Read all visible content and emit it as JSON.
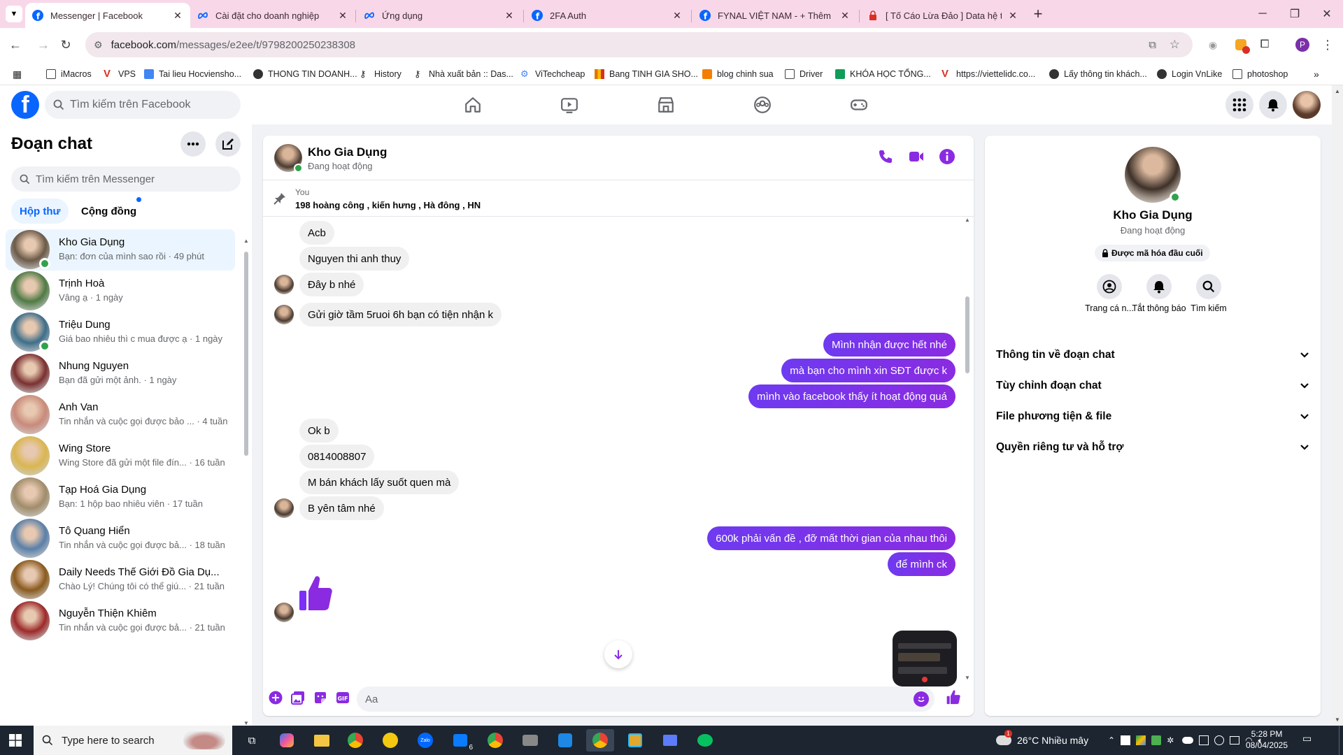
{
  "browser": {
    "tabs": [
      {
        "title": "Messenger | Facebook",
        "icon": "facebook-icon",
        "active": true
      },
      {
        "title": "Cài đặt cho doanh nghiệp",
        "icon": "meta-icon",
        "active": false
      },
      {
        "title": "Ứng dụng",
        "icon": "meta-icon",
        "active": false
      },
      {
        "title": "2FA Auth",
        "icon": "facebook-icon",
        "active": false
      },
      {
        "title": "FYNAL VIỆT NAM - + Thêm sản",
        "icon": "facebook-icon",
        "active": false
      },
      {
        "title": "[ Tố Cáo Lừa Đảo ] Data hệ thốn",
        "icon": "lock-icon",
        "active": false
      }
    ],
    "new_tab": "+",
    "url_host": "facebook.com",
    "url_path": "/messages/e2ee/t/9798200250238308",
    "profile_initial": "P",
    "bookmarks": [
      {
        "label": "iMacros",
        "icon": "folder-icon"
      },
      {
        "label": "VPS",
        "icon": "v-icon"
      },
      {
        "label": "Tai lieu Hocviensho...",
        "icon": "doc-icon"
      },
      {
        "label": "THONG TIN DOANH...",
        "icon": "globe-icon"
      },
      {
        "label": "History",
        "icon": "key-icon"
      },
      {
        "label": "Nhà xuất bản :: Das...",
        "icon": "key-icon"
      },
      {
        "label": "ViTechcheap",
        "icon": "gear-icon"
      },
      {
        "label": "Bang TINH GIA SHO...",
        "icon": "chart-icon"
      },
      {
        "label": "blog chinh sua",
        "icon": "blogger-icon"
      },
      {
        "label": "Driver",
        "icon": "folder-icon"
      },
      {
        "label": "KHÓA HỌC TỔNG...",
        "icon": "sheet-icon"
      },
      {
        "label": "https://viettelidc.co...",
        "icon": "v-icon"
      },
      {
        "label": "Lấy thông tin khách...",
        "icon": "globe-icon"
      },
      {
        "label": "Login VnLike",
        "icon": "globe-icon"
      },
      {
        "label": "photoshop",
        "icon": "folder-icon"
      }
    ]
  },
  "fb": {
    "search_placeholder": "Tìm kiếm trên Facebook",
    "logo_letter": "f"
  },
  "sidebar": {
    "title": "Đoạn chat",
    "search_placeholder": "Tìm kiếm trên Messenger",
    "tab_inbox": "Hộp thư",
    "tab_community": "Cộng đồng",
    "conversations": [
      {
        "name": "Kho Gia Dụng",
        "preview": "Bạn: đơn của mình sao rồi · 49 phút",
        "online": true,
        "active": true,
        "color": "#6b5a48"
      },
      {
        "name": "Trịnh Hoà",
        "preview": "Vâng ạ · 1 ngày",
        "online": false,
        "active": false,
        "color": "#4f7a45"
      },
      {
        "name": "Triệu Dung",
        "preview": "Giá bao nhiêu thì c mua được ạ · 1 ngày",
        "online": true,
        "active": false,
        "color": "#3d6e8a"
      },
      {
        "name": "Nhung Nguyen",
        "preview": "Bạn đã gửi một ảnh. · 1 ngày",
        "online": false,
        "active": false,
        "color": "#7a3030"
      },
      {
        "name": "Anh Van",
        "preview": "Tin nhắn và cuộc gọi được bảo ... · 4 tuần",
        "online": false,
        "active": false,
        "color": "#c98a7a"
      },
      {
        "name": "Wing Store",
        "preview": "Wing Store đã gửi một file đín... · 16 tuần",
        "online": false,
        "active": false,
        "color": "#d9b650"
      },
      {
        "name": "Tạp Hoá Gia Dụng",
        "preview": "Bạn: 1 hộp bao nhiêu viên · 17 tuần",
        "online": false,
        "active": false,
        "color": "#a08c6a"
      },
      {
        "name": "Tô Quang Hiển",
        "preview": "Tin nhắn và cuộc gọi được bả... · 18 tuần",
        "online": false,
        "active": false,
        "color": "#5a7fa8"
      },
      {
        "name": "Daily Needs Thế Giới Đồ Gia Dụ...",
        "preview": "Chào Lý! Chúng tôi có thể giú... · 21 tuần",
        "online": false,
        "active": false,
        "color": "#8a5a1e"
      },
      {
        "name": "Nguyễn Thiện Khiêm",
        "preview": "Tin nhắn và cuộc gọi được bả... · 21 tuần",
        "online": false,
        "active": false,
        "color": "#9c2a2a"
      }
    ]
  },
  "chat": {
    "name": "Kho Gia Dụng",
    "status": "Đang hoạt động",
    "pinned_sender": "You",
    "pinned_text": "198 hoàng công , kiến hưng , Hà đông , HN",
    "messages": [
      {
        "text": "Acb",
        "dir": "in",
        "avatar": false
      },
      {
        "text": "Nguyen thi anh thuy",
        "dir": "in",
        "avatar": false
      },
      {
        "text": "Đây b nhé",
        "dir": "in",
        "avatar": true
      },
      {
        "text": "Gửi giờ tầm 5ruoi 6h bạn có tiện nhận k",
        "dir": "in",
        "avatar": true
      },
      {
        "text": "Mình nhận được hết nhé",
        "dir": "out"
      },
      {
        "text": "mà bạn cho mình xin SĐT được k",
        "dir": "out"
      },
      {
        "text": "mình vào facebook thấy ít hoạt động quá",
        "dir": "out"
      },
      {
        "text": "Ok b",
        "dir": "in",
        "avatar": false
      },
      {
        "text": "0814008807",
        "dir": "in",
        "avatar": false
      },
      {
        "text": "M bán khách lấy suốt quen mà",
        "dir": "in",
        "avatar": false
      },
      {
        "text": "B yên tâm nhé",
        "dir": "in",
        "avatar": true
      },
      {
        "text": "600k phải vấn đề , đỡ mất thời gian của nhau thôi",
        "dir": "out"
      },
      {
        "text": "để mình ck",
        "dir": "out"
      }
    ],
    "composer_placeholder": "Aa"
  },
  "info": {
    "name": "Kho Gia Dụng",
    "status": "Đang hoạt động",
    "encryption": "Được mã hóa đầu cuối",
    "actions": [
      {
        "label": "Trang cá n...",
        "icon": "profile-icon"
      },
      {
        "label": "Tắt thông báo",
        "icon": "bell-icon"
      },
      {
        "label": "Tìm kiếm",
        "icon": "search-icon"
      }
    ],
    "sections": [
      "Thông tin về đoạn chat",
      "Tùy chỉnh đoạn chat",
      "File phương tiện & file",
      "Quyền riêng tư và hỗ trợ"
    ]
  },
  "taskbar": {
    "search_placeholder": "Type here to search",
    "weather": "26°C  Nhiều mây",
    "weather_badge": "1",
    "time": "5:28 PM",
    "date": "08/04/2025",
    "zalo_badge": "6"
  },
  "colors": {
    "fb_blue": "#0866ff",
    "messenger_purple": "#8a2be2",
    "tab_bg": "#f8d7e8"
  }
}
